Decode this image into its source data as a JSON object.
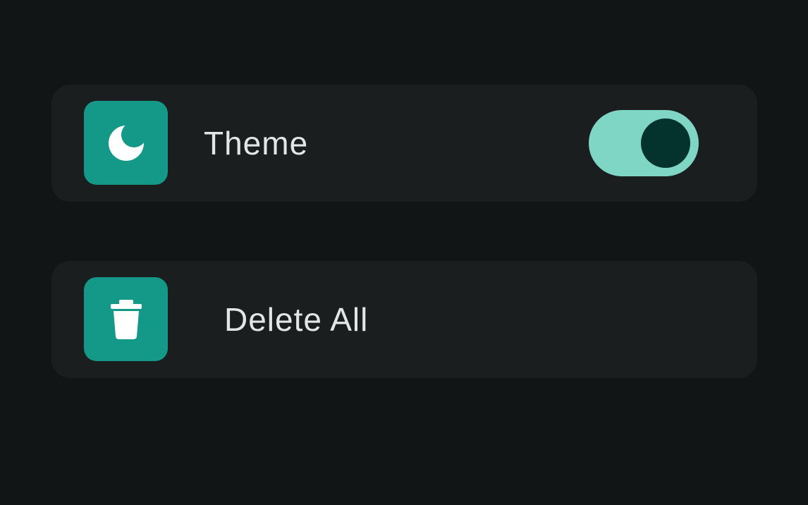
{
  "colors": {
    "background": "#111516",
    "card": "#1a1e1f",
    "accent": "#149888",
    "switch_track_on": "#7fd6c5",
    "switch_thumb_on": "#03332c",
    "text": "#e3e6e6"
  },
  "settings": {
    "theme": {
      "label": "Theme",
      "icon": "moon-icon",
      "toggle_on": true
    },
    "delete_all": {
      "label": "Delete All",
      "icon": "trash-icon"
    }
  }
}
